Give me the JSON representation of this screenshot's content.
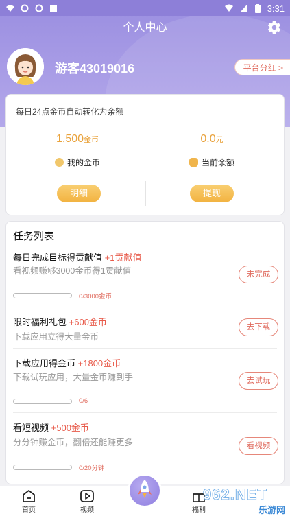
{
  "status_bar": {
    "time": "3:31"
  },
  "header": {
    "title": "个人中心"
  },
  "profile": {
    "username": "游客43019016",
    "bonus_button": "平台分红 >"
  },
  "wallet": {
    "note": "每日24点金币自动转化为余额",
    "coins": {
      "value": "1,500",
      "unit": "金币",
      "label": "我的金币"
    },
    "balance": {
      "value": "0.0",
      "unit": "元",
      "label": "当前余额"
    },
    "detail_button": "明细",
    "withdraw_button": "提现"
  },
  "tasks": {
    "heading": "任务列表",
    "items": [
      {
        "title": "每日完成目标得贡献值",
        "reward": "+1贡献值",
        "desc": "看视频赚够3000金币得1贡献值",
        "progress_text": "0/3000金币",
        "progress": 0,
        "button": "未完成"
      },
      {
        "title": "限时福利礼包",
        "reward": "+600金币",
        "desc": "下载应用立得大量金币",
        "button": "去下载"
      },
      {
        "title": "下载应用得金币",
        "reward": "+1800金币",
        "desc": "下载试玩应用，大量金币赚到手",
        "progress_text": "0/6",
        "progress": 0,
        "button": "去试玩"
      },
      {
        "title": "看短视频",
        "reward": "+500金币",
        "desc": "分分钟赚金币，翻倍还能赚更多",
        "progress_text": "0/20分钟",
        "progress": 0,
        "button": "看视频"
      }
    ]
  },
  "bottom_nav": {
    "items": [
      {
        "label": "首页",
        "icon": "home-icon"
      },
      {
        "label": "视频",
        "icon": "video-icon"
      },
      {
        "label": "",
        "icon": "rocket-icon"
      },
      {
        "label": "福利",
        "icon": "gift-icon"
      }
    ]
  },
  "watermark": {
    "main": "962.NET",
    "sub": "乐游网"
  },
  "colors": {
    "accent": "#9a8ee0",
    "gold": "#e9a23b",
    "reward_red": "#e85b4b"
  }
}
